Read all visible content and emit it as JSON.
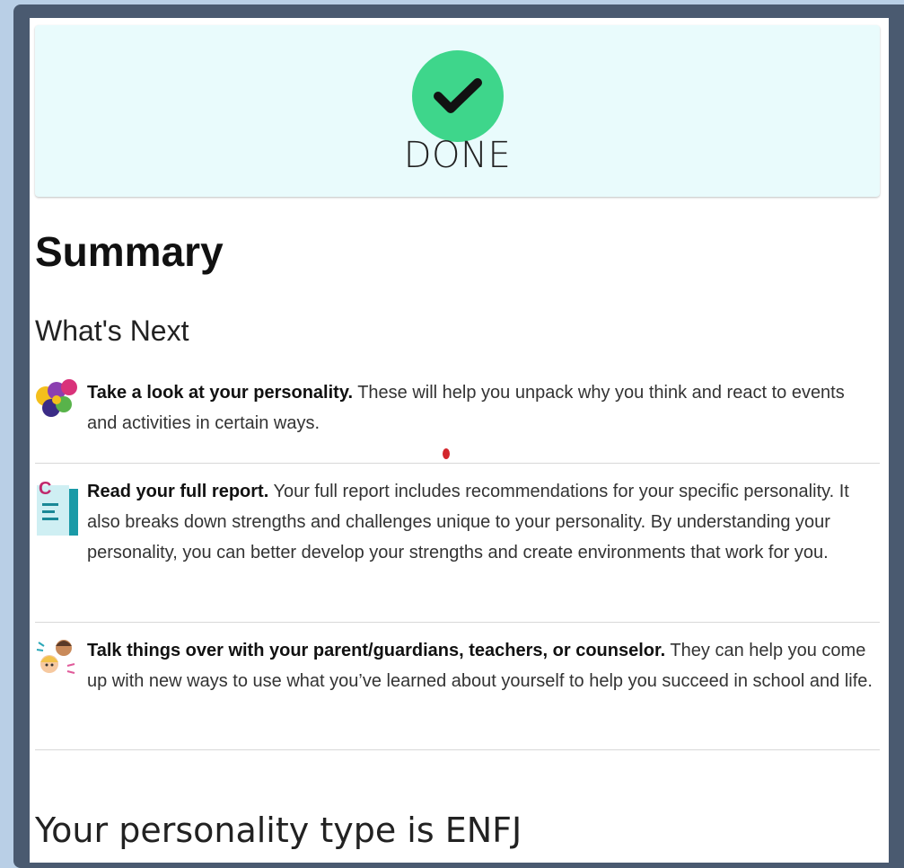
{
  "status": {
    "label": "DONE",
    "icon": "checkmark-icon",
    "accent_color": "#3ed68b"
  },
  "summary": {
    "title": "Summary",
    "next_title": "What's Next",
    "steps": [
      {
        "icon": "personality-bubbles-icon",
        "bold": "Take a look at your personality.",
        "text": " These will help you unpack why you think and react to events and activities in certain ways."
      },
      {
        "icon": "report-document-icon",
        "bold": "Read your full report.",
        "text": " Your full report includes recommendations for your specific personality. It also breaks down strengths and challenges unique to your personality. By understanding your personality, you can better develop your strengths and create environments that work for you."
      },
      {
        "icon": "people-talking-icon",
        "bold": "Talk things over with your parent/guardians, teachers, or counselor.",
        "text": " They can help you come up with new ways to use what you’ve learned about yourself to help you succeed in school and life."
      }
    ]
  },
  "personality": {
    "heading": "Your personality type is ENFJ"
  }
}
